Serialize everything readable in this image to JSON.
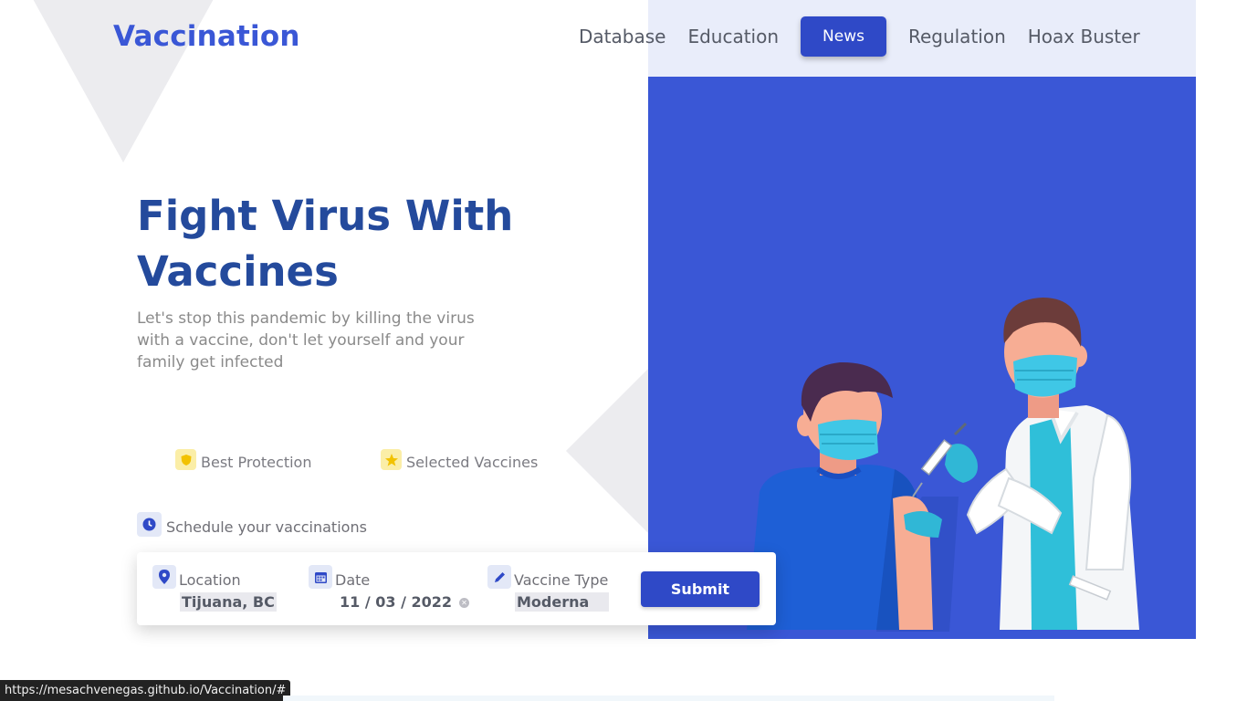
{
  "header": {
    "logo": "Vaccination",
    "nav": [
      {
        "label": "Database",
        "active": false
      },
      {
        "label": "Education",
        "active": false
      },
      {
        "label": "News",
        "active": true
      },
      {
        "label": "Regulation",
        "active": false
      },
      {
        "label": "Hoax Buster",
        "active": false
      }
    ]
  },
  "hero": {
    "title": "Fight Virus With Vaccines",
    "subtitle": "Let's stop this pandemic by killing the virus with a vaccine, don't let yourself and your family get infected",
    "features": [
      {
        "label": "Best Protection",
        "icon": "shield-icon"
      },
      {
        "label": "Selected Vaccines",
        "icon": "star-icon"
      }
    ],
    "illustration": "doctor-vaccinating-patient"
  },
  "schedule": {
    "label": "Schedule your vaccinations",
    "icon": "clock-icon",
    "fields": {
      "location": {
        "label": "Location",
        "value": "Tijuana, BC",
        "icon": "location-pin-icon"
      },
      "date": {
        "label": "Date",
        "value": "11 / 03 / 2022",
        "icon": "calendar-icon"
      },
      "vaccine_type": {
        "label": "Vaccine Type",
        "value": "Moderna",
        "icon": "pencil-icon"
      }
    },
    "submit_label": "Submit"
  },
  "status_bar": {
    "url": "https://mesachvenegas.github.io/Vaccination/#"
  },
  "colors": {
    "brand_blue": "#3a57d6",
    "button_blue": "#2f49c7",
    "title_blue": "#244a9c",
    "nav_bg": "#e9edfa",
    "feature_icon_bg": "#fbeea7",
    "schedule_icon_bg": "#e3e8f7"
  }
}
